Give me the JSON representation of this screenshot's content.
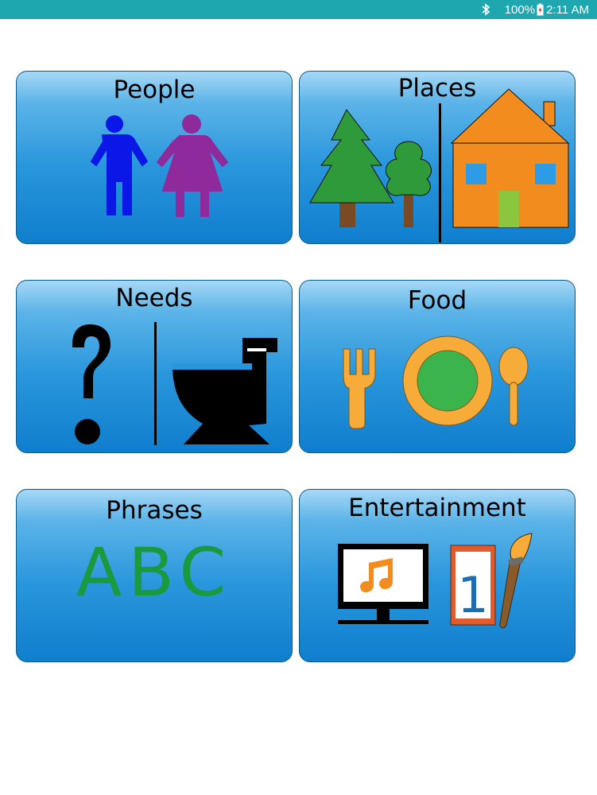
{
  "status_bar": {
    "bluetooth_icon": "bluetooth-icon",
    "battery_text": "100%",
    "battery_icon": "battery-charging-icon",
    "time": "2:11 AM"
  },
  "tiles": [
    {
      "label": "People",
      "icons": [
        "man-icon",
        "woman-icon"
      ]
    },
    {
      "label": "Places",
      "icons": [
        "trees-icon",
        "house-icon"
      ]
    },
    {
      "label": "Needs",
      "icons": [
        "question-mark-icon",
        "toilet-icon"
      ]
    },
    {
      "label": "Food",
      "icons": [
        "fork-icon",
        "plate-icon",
        "spoon-icon"
      ]
    },
    {
      "label": "Phrases",
      "text": "ABC"
    },
    {
      "label": "Entertainment",
      "icons": [
        "music-monitor-icon",
        "number-card-icon",
        "paintbrush-icon"
      ],
      "card_number": "1"
    }
  ],
  "colors": {
    "status_bar": "#1fa7b0",
    "tile_top": "#a6d8f6",
    "tile_bottom": "#0f7ecd",
    "abc_text": "#1a9a3e"
  }
}
